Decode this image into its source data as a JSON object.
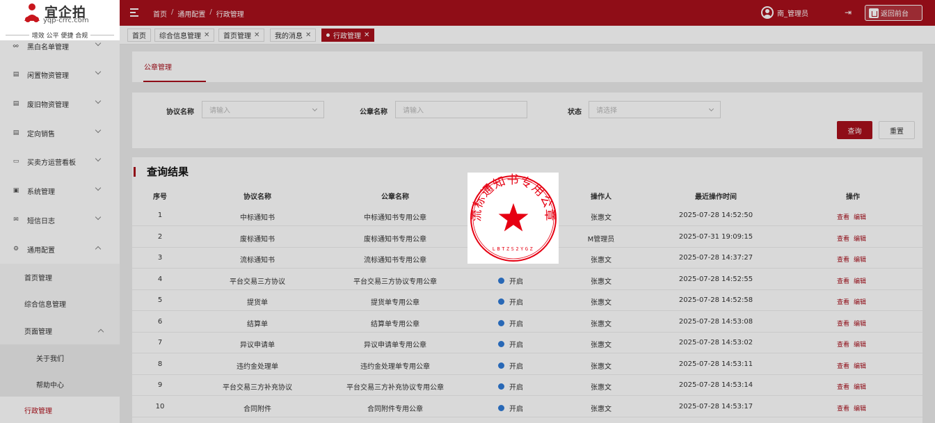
{
  "brand": {
    "name": "宜企拍",
    "url": "yqp-crrc.com",
    "slogan": "增效 公平 便捷 合规"
  },
  "sidebar": {
    "items": [
      {
        "label": "黑白名单管理",
        "icon": "user-list-icon"
      },
      {
        "label": "闲置物资管理",
        "icon": "document-icon"
      },
      {
        "label": "废旧物资管理",
        "icon": "document-icon"
      },
      {
        "label": "定向销售",
        "icon": "document-icon"
      },
      {
        "label": "买卖方运营看板",
        "icon": "monitor-icon"
      },
      {
        "label": "系统管理",
        "icon": "window-icon"
      },
      {
        "label": "短信日志",
        "icon": "mail-icon"
      },
      {
        "label": "通用配置",
        "icon": "gear-icon"
      }
    ],
    "sub": {
      "home": "首页管理",
      "info": "综合信息管理",
      "page": "页面管理",
      "about": "关于我们",
      "help": "帮助中心",
      "admin": "行政管理"
    }
  },
  "header": {
    "breadcrumb": [
      "首页",
      "通用配置",
      "行政管理"
    ],
    "user": "南_管理员",
    "return_label": "返回前台"
  },
  "tabs": [
    "首页",
    "综合信息管理",
    "首页管理",
    "我的消息",
    "行政管理"
  ],
  "page": {
    "subtab": "公章管理",
    "filters": {
      "agreement_label": "协议名称",
      "agreement_placeholder": "请输入",
      "seal_label": "公章名称",
      "seal_placeholder": "请输入",
      "status_label": "状态",
      "status_placeholder": "请选择"
    },
    "query_btn": "查询",
    "reset_btn": "重置",
    "result_title": "查询结果",
    "columns": [
      "序号",
      "协议名称",
      "公章名称",
      "状态",
      "操作人",
      "最近操作时间",
      "操作"
    ],
    "actions": {
      "view": "查看",
      "edit": "编辑"
    },
    "rows": [
      {
        "no": "1",
        "agreement": "中标通知书",
        "seal": "中标通知书专用公章",
        "status": "开启",
        "operator": "张惠文",
        "time": "2025-07-28 14:52:50"
      },
      {
        "no": "2",
        "agreement": "废标通知书",
        "seal": "废标通知书专用公章",
        "status": "开启",
        "operator": "M管理员",
        "time": "2025-07-31 19:09:15"
      },
      {
        "no": "3",
        "agreement": "流标通知书",
        "seal": "流标通知书专用公章",
        "status": "开启",
        "operator": "张惠文",
        "time": "2025-07-28 14:37:27"
      },
      {
        "no": "4",
        "agreement": "平台交易三方协议",
        "seal": "平台交易三方协议专用公章",
        "status": "开启",
        "operator": "张惠文",
        "time": "2025-07-28 14:52:55"
      },
      {
        "no": "5",
        "agreement": "提货单",
        "seal": "提货单专用公章",
        "status": "开启",
        "operator": "张惠文",
        "time": "2025-07-28 14:52:58"
      },
      {
        "no": "6",
        "agreement": "结算单",
        "seal": "结算单专用公章",
        "status": "开启",
        "operator": "张惠文",
        "time": "2025-07-28 14:53:08"
      },
      {
        "no": "7",
        "agreement": "异议申请单",
        "seal": "异议申请单专用公章",
        "status": "开启",
        "operator": "张惠文",
        "time": "2025-07-28 14:53:02"
      },
      {
        "no": "8",
        "agreement": "违约金处理单",
        "seal": "违约金处理单专用公章",
        "status": "开启",
        "operator": "张惠文",
        "time": "2025-07-28 14:53:11"
      },
      {
        "no": "9",
        "agreement": "平台交易三方补充协议",
        "seal": "平台交易三方补充协议专用公章",
        "status": "开启",
        "operator": "张惠文",
        "time": "2025-07-28 14:53:14"
      },
      {
        "no": "10",
        "agreement": "合同附件",
        "seal": "合同附件专用公章",
        "status": "开启",
        "operator": "张惠文",
        "time": "2025-07-28 14:53:17"
      }
    ]
  },
  "stamp_preview": {
    "text": "流标通知书专用公章",
    "code": "LBTZS2YGZ"
  },
  "colors": {
    "primary": "#a8101c",
    "status_on": "#2f7bd6",
    "stamp": "#e60012"
  }
}
